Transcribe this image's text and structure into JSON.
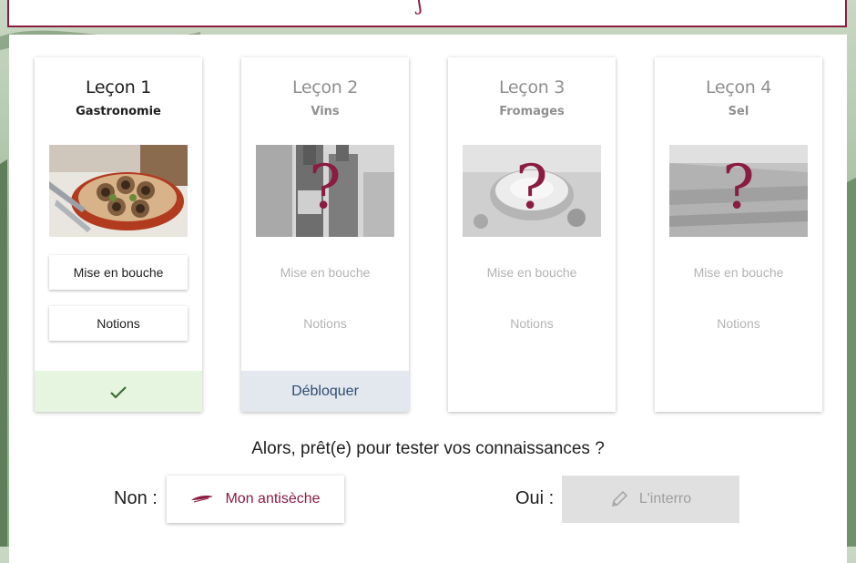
{
  "colors": {
    "accent": "#8a1c3f",
    "done_bg": "#e6f5df",
    "unlock_bg": "#e3e8ef",
    "unlock_text": "#2e4c72",
    "disabled_text": "#b3b3b3"
  },
  "lessons": [
    {
      "title": "Leçon 1",
      "subtitle": "Gastronomie",
      "locked": false,
      "image": "escargots-dish",
      "buttons": [
        "Mise en bouche",
        "Notions"
      ],
      "footer_icon": "check-icon"
    },
    {
      "title": "Leçon 2",
      "subtitle": "Vins",
      "locked": true,
      "image": "wine-bottles",
      "overlay": "?",
      "buttons": [
        "Mise en bouche",
        "Notions"
      ],
      "footer_label": "Débloquer"
    },
    {
      "title": "Leçon 3",
      "subtitle": "Fromages",
      "locked": true,
      "image": "cheese",
      "overlay": "?",
      "buttons": [
        "Mise en bouche",
        "Notions"
      ]
    },
    {
      "title": "Leçon 4",
      "subtitle": "Sel",
      "locked": true,
      "image": "salt-marsh",
      "overlay": "?",
      "buttons": [
        "Mise en bouche",
        "Notions"
      ]
    }
  ],
  "quiz_section": {
    "question": "Alors, prêt(e) pour tester vos connaissances ?",
    "no_label": "Non :",
    "cheat_button": "Mon antisèche",
    "cheat_icon": "quill-icon",
    "yes_label": "Oui :",
    "quiz_button": "L'interro",
    "quiz_icon": "pencil-icon"
  }
}
